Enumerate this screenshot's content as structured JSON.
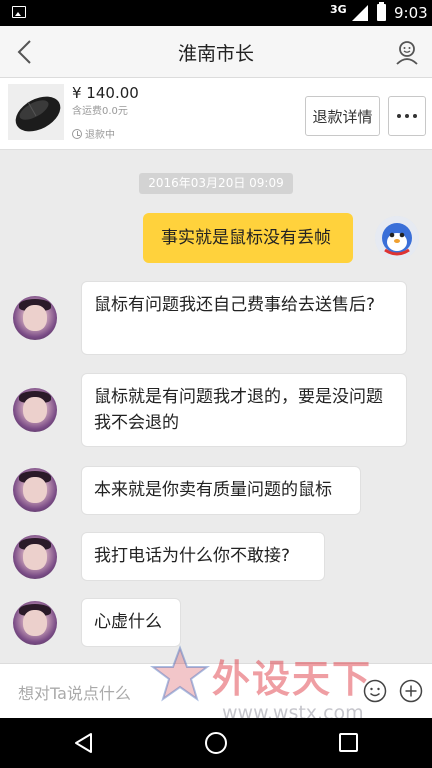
{
  "status_bar": {
    "network": "3G",
    "time": "9:03"
  },
  "header": {
    "title": "淮南市长",
    "back_icon": "back-arrow-icon",
    "profile_icon": "user-profile-icon"
  },
  "product": {
    "price": "¥ 140.00",
    "shipping": "含运费0.0元",
    "refund_status": "退款中",
    "detail_button": "退款详情",
    "more_icon": "more-dots-icon"
  },
  "chat": {
    "timestamp": "2016年03月20日 09:09",
    "messages": [
      {
        "side": "right",
        "text": "事实就是鼠标没有丢帧"
      },
      {
        "side": "left",
        "text": "鼠标有问题我还自己费事给去送售后?"
      },
      {
        "side": "left",
        "text": "鼠标就是有问题我才退的，要是没问题我不会退的"
      },
      {
        "side": "left",
        "text": "本来就是你卖有质量问题的鼠标"
      },
      {
        "side": "left",
        "text": "我打电话为什么你不敢接?"
      },
      {
        "side": "left",
        "text": "心虚什么"
      }
    ]
  },
  "input": {
    "placeholder": "想对Ta说点什么",
    "emoji_icon": "emoji-icon",
    "plus_icon": "plus-icon"
  },
  "watermark": {
    "text": "外设天下",
    "url": "www.wstx.com"
  },
  "colors": {
    "accent_bubble": "#ffd23c",
    "background": "#ebebeb"
  }
}
